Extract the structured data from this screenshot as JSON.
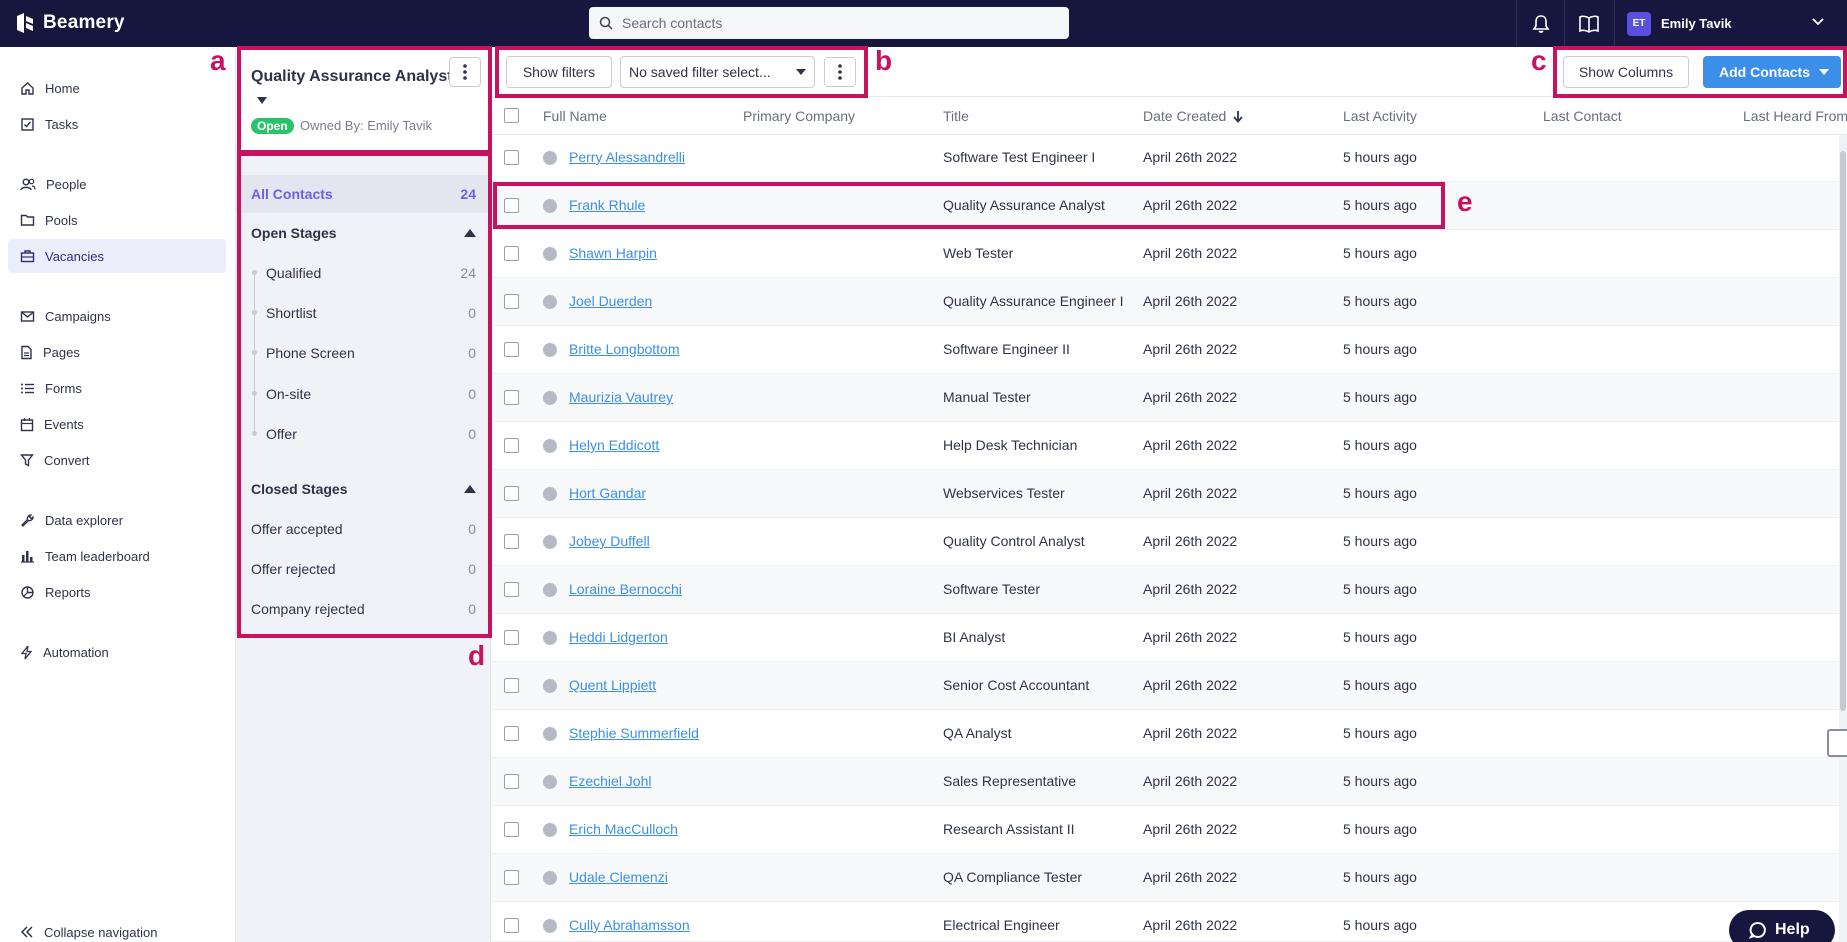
{
  "app": {
    "brand": "Beamery"
  },
  "search": {
    "placeholder": "Search contacts"
  },
  "user": {
    "initials": "ET",
    "name": "Emily Tavik"
  },
  "nav": {
    "items": [
      {
        "label": "Home",
        "icon": "home-icon"
      },
      {
        "label": "Tasks",
        "icon": "tasks-icon"
      },
      {
        "label": "People",
        "icon": "people-icon"
      },
      {
        "label": "Pools",
        "icon": "folder-icon"
      },
      {
        "label": "Vacancies",
        "icon": "briefcase-icon"
      },
      {
        "label": "Campaigns",
        "icon": "mail-icon"
      },
      {
        "label": "Pages",
        "icon": "page-icon"
      },
      {
        "label": "Forms",
        "icon": "list-icon"
      },
      {
        "label": "Events",
        "icon": "calendar-icon"
      },
      {
        "label": "Convert",
        "icon": "funnel-icon"
      },
      {
        "label": "Data explorer",
        "icon": "wrench-icon"
      },
      {
        "label": "Team leaderboard",
        "icon": "bar-chart-icon"
      },
      {
        "label": "Reports",
        "icon": "pie-chart-icon"
      },
      {
        "label": "Automation",
        "icon": "bolt-icon"
      }
    ],
    "active": "Vacancies",
    "collapse": "Collapse navigation"
  },
  "vacancy": {
    "title": "Quality Assurance Analyst",
    "status": "Open",
    "owned_by": "Owned By: Emily Tavik",
    "all_contacts": {
      "label": "All Contacts",
      "count": "24"
    },
    "open_stages": {
      "label": "Open Stages",
      "items": [
        {
          "label": "Qualified",
          "count": "24"
        },
        {
          "label": "Shortlist",
          "count": "0"
        },
        {
          "label": "Phone Screen",
          "count": "0"
        },
        {
          "label": "On-site",
          "count": "0"
        },
        {
          "label": "Offer",
          "count": "0"
        }
      ]
    },
    "closed_stages": {
      "label": "Closed Stages",
      "items": [
        {
          "label": "Offer accepted",
          "count": "0"
        },
        {
          "label": "Offer rejected",
          "count": "0"
        },
        {
          "label": "Company rejected",
          "count": "0"
        }
      ]
    }
  },
  "toolbar": {
    "show_filters": "Show filters",
    "saved_filter": "No saved filter select...",
    "show_columns": "Show Columns",
    "add_contacts": "Add Contacts"
  },
  "table": {
    "columns": [
      "Full Name",
      "Primary Company",
      "Title",
      "Date Created",
      "Last Activity",
      "Last Contact",
      "Last Heard From"
    ],
    "sort_column": "Date Created",
    "rows": [
      {
        "name": "Perry Alessandrelli",
        "title": "Software Test Engineer I",
        "date": "April 26th 2022",
        "activity": "5 hours ago"
      },
      {
        "name": "Frank Rhule",
        "title": "Quality Assurance Analyst",
        "date": "April 26th 2022",
        "activity": "5 hours ago"
      },
      {
        "name": "Shawn Harpin",
        "title": "Web Tester",
        "date": "April 26th 2022",
        "activity": "5 hours ago"
      },
      {
        "name": "Joel Duerden",
        "title": "Quality Assurance Engineer I",
        "date": "April 26th 2022",
        "activity": "5 hours ago"
      },
      {
        "name": "Britte Longbottom",
        "title": "Software Engineer II",
        "date": "April 26th 2022",
        "activity": "5 hours ago"
      },
      {
        "name": "Maurizia Vautrey",
        "title": "Manual Tester",
        "date": "April 26th 2022",
        "activity": "5 hours ago"
      },
      {
        "name": "Helyn Eddicott",
        "title": "Help Desk Technician",
        "date": "April 26th 2022",
        "activity": "5 hours ago"
      },
      {
        "name": "Hort Gandar",
        "title": "Webservices Tester",
        "date": "April 26th 2022",
        "activity": "5 hours ago"
      },
      {
        "name": "Jobey Duffell",
        "title": "Quality Control Analyst",
        "date": "April 26th 2022",
        "activity": "5 hours ago"
      },
      {
        "name": "Loraine Bernocchi",
        "title": "Software Tester",
        "date": "April 26th 2022",
        "activity": "5 hours ago"
      },
      {
        "name": "Heddi Lidgerton",
        "title": "BI Analyst",
        "date": "April 26th 2022",
        "activity": "5 hours ago"
      },
      {
        "name": "Quent Lippiett",
        "title": "Senior Cost Accountant",
        "date": "April 26th 2022",
        "activity": "5 hours ago"
      },
      {
        "name": "Stephie Summerfield",
        "title": "QA Analyst",
        "date": "April 26th 2022",
        "activity": "5 hours ago"
      },
      {
        "name": "Ezechiel Johl",
        "title": "Sales Representative",
        "date": "April 26th 2022",
        "activity": "5 hours ago"
      },
      {
        "name": "Erich MacCulloch",
        "title": "Research Assistant II",
        "date": "April 26th 2022",
        "activity": "5 hours ago"
      },
      {
        "name": "Udale Clemenzi",
        "title": "QA Compliance Tester",
        "date": "April 26th 2022",
        "activity": "5 hours ago"
      },
      {
        "name": "Cully Abrahamsson",
        "title": "Electrical Engineer",
        "date": "April 26th 2022",
        "activity": "5 hours ago"
      }
    ]
  },
  "help": {
    "label": "Help"
  },
  "annotations": {
    "a": "a",
    "b": "b",
    "c": "c",
    "d": "d",
    "e": "e"
  },
  "colors": {
    "topbar": "#16163f",
    "accent": "#3b8fe8",
    "annotation": "#c8125f",
    "open_badge": "#27c46b",
    "active_link": "#6c63d8"
  }
}
